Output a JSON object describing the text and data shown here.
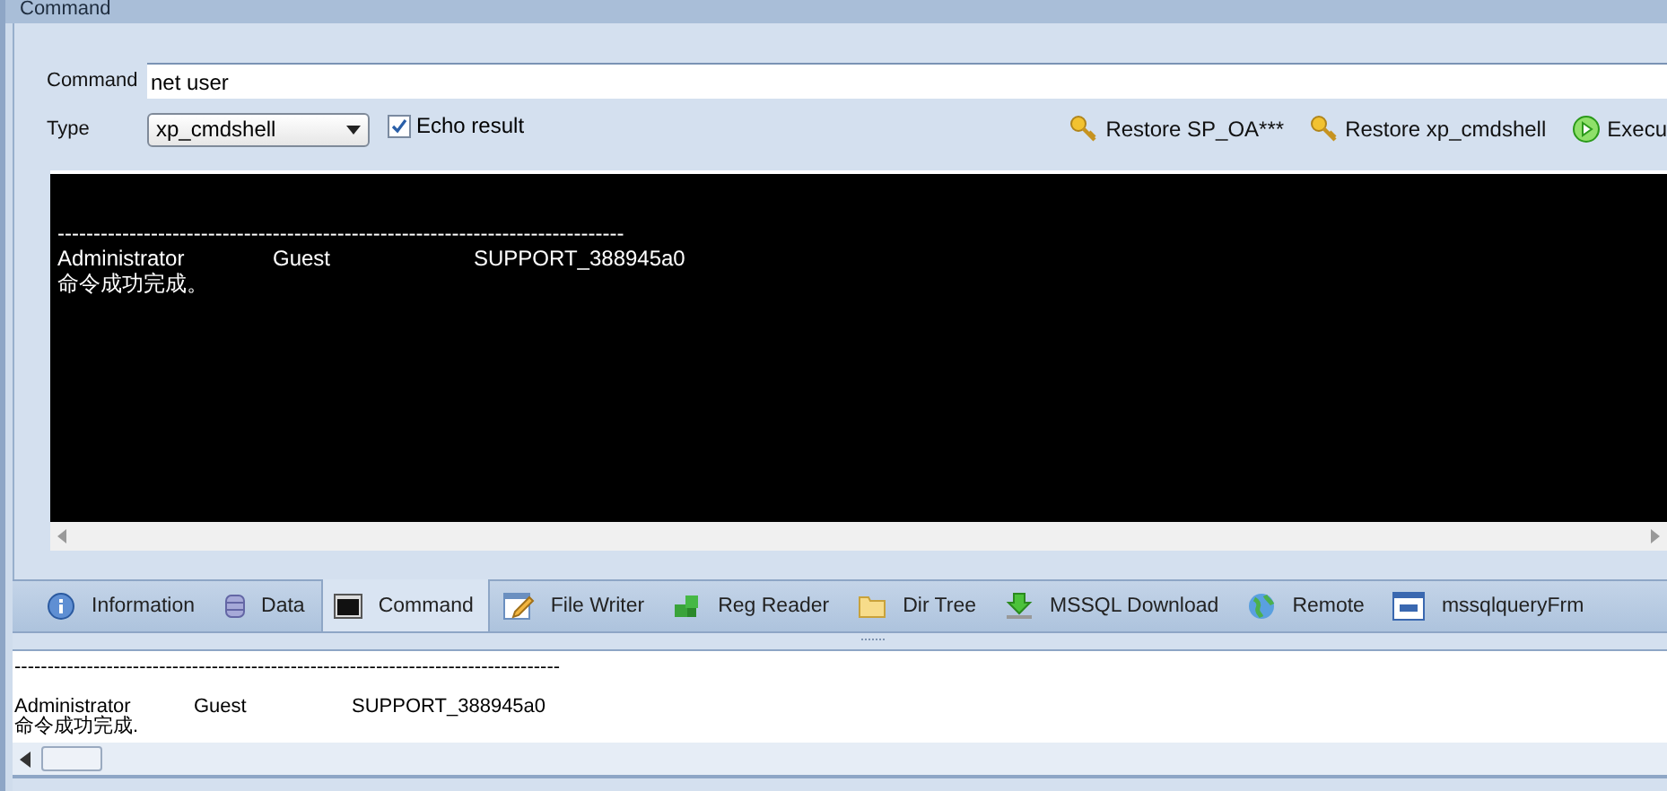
{
  "panel": {
    "title": "Command"
  },
  "command": {
    "label": "Command",
    "value": "net user"
  },
  "type": {
    "label": "Type",
    "value": "xp_cmdshell"
  },
  "echo": {
    "label": "Echo result",
    "checked": true
  },
  "actions": [
    {
      "kind": "key",
      "label": "Restore SP_OA***"
    },
    {
      "kind": "key",
      "label": "Restore xp_cmdshell"
    },
    {
      "kind": "run",
      "label": "Execu"
    }
  ],
  "console": {
    "lines": [
      {
        "kind": "blank"
      },
      {
        "kind": "rule",
        "cells": [
          "-------------------------------------------------------------------------------"
        ]
      },
      {
        "kind": "cols",
        "cells": [
          "Administrator",
          "Guest",
          "SUPPORT_388945a0"
        ]
      },
      {
        "kind": "text",
        "cells": [
          "命令成功完成。"
        ]
      }
    ]
  },
  "tabs": [
    {
      "label": "Information",
      "selected": false
    },
    {
      "label": "Data",
      "selected": false
    },
    {
      "label": "Command",
      "selected": true
    },
    {
      "label": "File Writer",
      "selected": false
    },
    {
      "label": "Reg Reader",
      "selected": false
    },
    {
      "label": "Dir Tree",
      "selected": false
    },
    {
      "label": "MSSQL Download",
      "selected": false
    },
    {
      "label": "Remote",
      "selected": false
    },
    {
      "label": "mssqlqueryFrm",
      "selected": false
    }
  ],
  "output": {
    "lines": [
      {
        "kind": "rule",
        "cells": [
          "-----------------------------------------------------------------------------------"
        ]
      },
      {
        "kind": "blank"
      },
      {
        "kind": "cols",
        "cells": [
          "Administrator",
          "Guest",
          "SUPPORT_388945a0"
        ]
      },
      {
        "kind": "text",
        "cells": [
          "命令成功完成."
        ]
      }
    ]
  }
}
